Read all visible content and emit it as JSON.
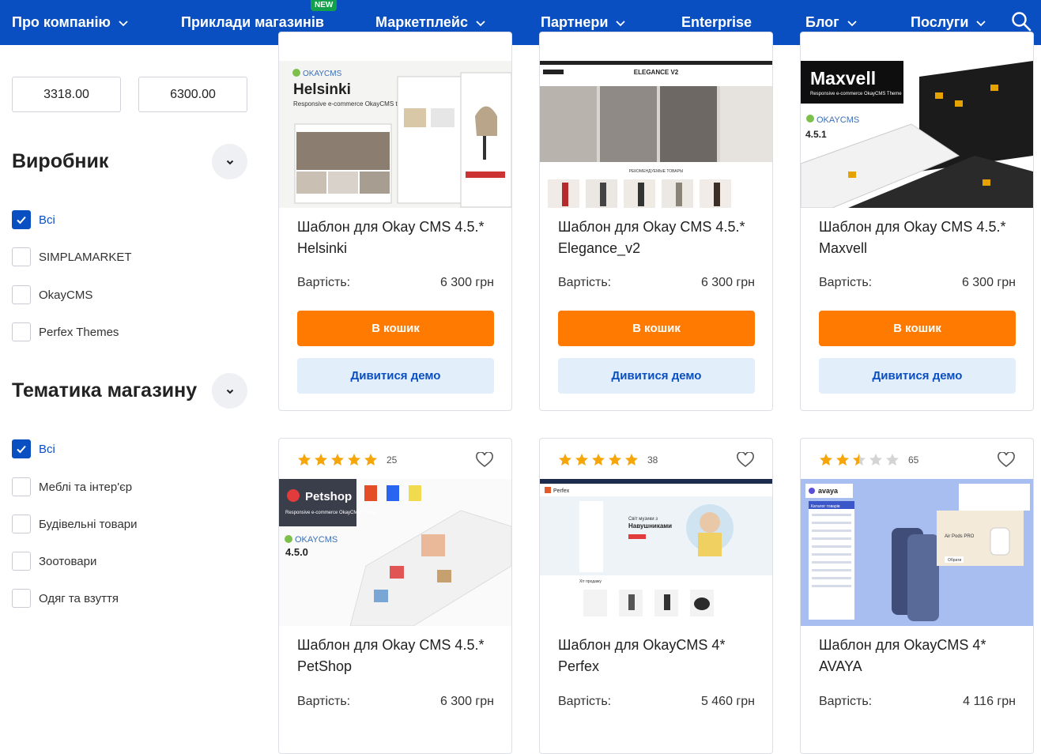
{
  "nav": {
    "items": [
      {
        "label": "Про компанію",
        "chevron": true
      },
      {
        "label": "Приклади магазинів",
        "chevron": false,
        "badge": "NEW"
      },
      {
        "label": "Маркетплейс",
        "chevron": true
      },
      {
        "label": "Партнери",
        "chevron": true
      },
      {
        "label": "Enterprise",
        "chevron": false
      },
      {
        "label": "Блог",
        "chevron": true
      },
      {
        "label": "Послуги",
        "chevron": true
      }
    ],
    "search_icon": "search-icon",
    "background": "#0a4fc1"
  },
  "sidebar": {
    "price_min": "3318.00",
    "price_max": "6300.00",
    "manufacturer": {
      "title": "Виробник",
      "options": [
        {
          "label": "Всі",
          "checked": true
        },
        {
          "label": "SIMPLAMARKET",
          "checked": false
        },
        {
          "label": "OkayCMS",
          "checked": false
        },
        {
          "label": "Perfex Themes",
          "checked": false
        }
      ]
    },
    "theme": {
      "title": "Тематика магазину",
      "options": [
        {
          "label": "Всі",
          "checked": true
        },
        {
          "label": "Меблі та інтер'єр",
          "checked": false
        },
        {
          "label": "Будівельні товари",
          "checked": false
        },
        {
          "label": "Зоотовари",
          "checked": false
        },
        {
          "label": "Одяг та взуття",
          "checked": false
        }
      ]
    }
  },
  "products": [
    {
      "title": "Шаблон для Okay CMS 4.5.* Helsinki",
      "price_label": "Вартість:",
      "price": "6 300  грн",
      "cart": "В кошик",
      "demo": "Дивитися демо",
      "thumb": {
        "brand": "OKAYCMS",
        "name": "Helsinki",
        "sub": "Responsive e-commerce OkayCMS theme"
      }
    },
    {
      "title": "Шаблон для Okay CMS 4.5.* Elegance_v2",
      "price_label": "Вартість:",
      "price": "6 300  грн",
      "cart": "В кошик",
      "demo": "Дивитися демо",
      "thumb": {
        "name": "ELEGANCE V2",
        "sub": "РЕКОМЕНДУЕМЫЕ ТОВАРЫ"
      }
    },
    {
      "title": "Шаблон для Okay CMS 4.5.* Maxvell",
      "price_label": "Вартість:",
      "price": "6 300  грн",
      "cart": "В кошик",
      "demo": "Дивитися демо",
      "thumb": {
        "name": "Maxvell",
        "sub": "Responsive e-commerce OkayCMS Theme",
        "brand": "OKAYCMS",
        "version": "4.5.1"
      }
    },
    {
      "title": "Шаблон для Okay CMS 4.5.* PetShop",
      "price_label": "Вартість:",
      "price": "6 300  грн",
      "rating": 5,
      "reviews": "25",
      "thumb": {
        "name": "Petshop",
        "sub": "Responsive e-commerce OkayCMS Theme",
        "brand": "OKAYCMS",
        "version": "4.5.0"
      }
    },
    {
      "title": "Шаблон для OkayCMS 4* Perfex",
      "price_label": "Вартість:",
      "price": "5 460  грн",
      "rating": 5,
      "reviews": "38",
      "thumb": {
        "name": "Perfex",
        "headline": "Світ музики з Навушниками",
        "sub": "Хіт продажу"
      }
    },
    {
      "title": "Шаблон для OkayCMS 4* AVAYA",
      "price_label": "Вартість:",
      "price": "4 116  грн",
      "rating": 2.5,
      "reviews": "65",
      "thumb": {
        "name": "avaya",
        "menu": "Каталог товарів",
        "product": "Air Pods PRO",
        "buy": "Обрати"
      }
    }
  ],
  "colors": {
    "accent": "#0a4fc1",
    "cart_button": "#ff7a00",
    "demo_button_bg": "#e3eefb",
    "star": "#f6a609",
    "new_badge": "#12a04b"
  }
}
